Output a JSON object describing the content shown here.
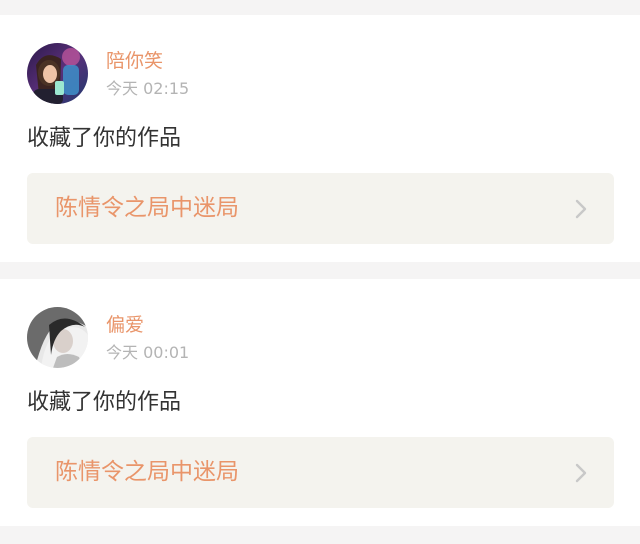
{
  "notifications": [
    {
      "username": "陪你笑",
      "time": "今天 02:15",
      "action": "收藏了你的作品",
      "work_title": "陈情令之局中迷局",
      "avatar_icon": "avatar-photo-icon"
    },
    {
      "username": "偏爱",
      "time": "今天 00:01",
      "action": "收藏了你的作品",
      "work_title": "陈情令之局中迷局",
      "avatar_icon": "avatar-photo-icon"
    }
  ],
  "colors": {
    "accent": "#e9956a",
    "muted": "#b4b4b4",
    "text": "#333333",
    "link_background": "#f4f3ee",
    "page_background": "#f5f4f4",
    "chevron": "#c8c8c8"
  },
  "icons": {
    "chevron": "chevron-right-icon"
  }
}
